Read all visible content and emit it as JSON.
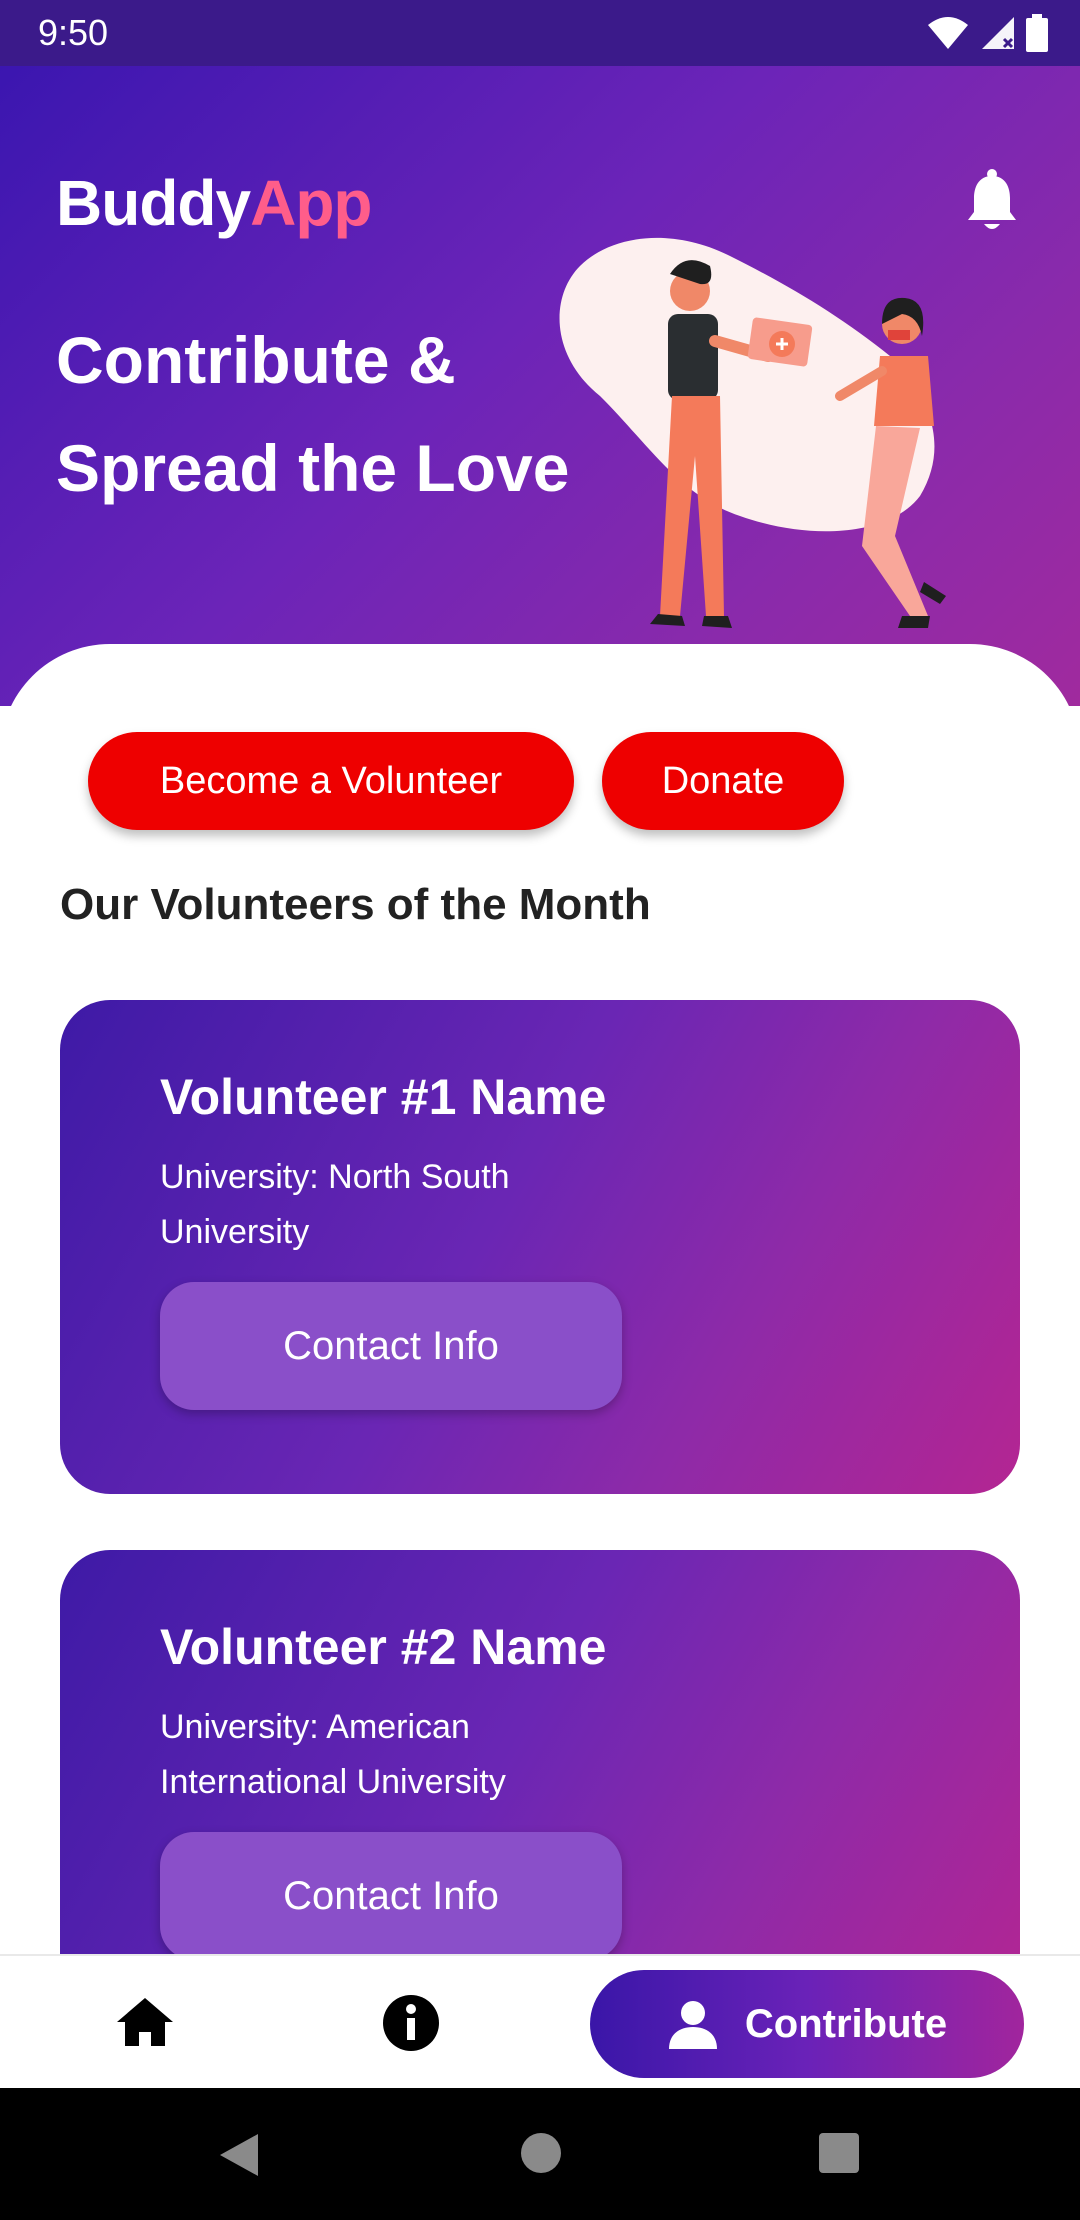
{
  "status_bar": {
    "time": "9:50"
  },
  "header": {
    "brand_part1": "Buddy",
    "brand_part2": "App",
    "headline_line1": "Contribute &",
    "headline_line2": "Spread the Love"
  },
  "actions": {
    "volunteer_label": "Become a Volunteer",
    "donate_label": "Donate"
  },
  "section": {
    "title": "Our Volunteers of the Month"
  },
  "volunteers": [
    {
      "name": "Volunteer #1 Name",
      "university": "University: North South University",
      "contact_label": "Contact Info"
    },
    {
      "name": "Volunteer #2 Name",
      "university": "University: American International University",
      "contact_label": "Contact Info"
    }
  ],
  "bottom_nav": {
    "contribute_label": "Contribute"
  },
  "colors": {
    "primary_purple": "#3b16b0",
    "accent_magenta": "#b42592",
    "brand_pink": "#ff5d8a",
    "action_red": "#ee0000"
  },
  "icons": [
    "wifi-icon",
    "signal-icon",
    "battery-icon",
    "bell-icon",
    "home-icon",
    "info-icon",
    "person-icon",
    "back-icon",
    "home-circle-icon",
    "recents-icon"
  ]
}
